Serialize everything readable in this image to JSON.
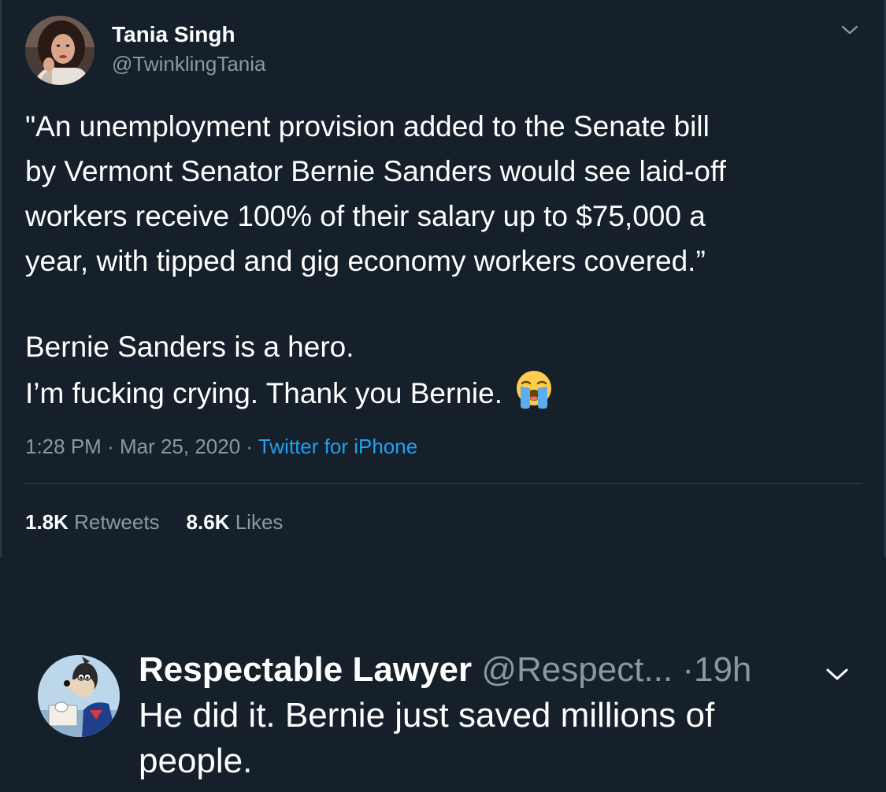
{
  "tweet": {
    "author": {
      "display_name": "Tania Singh",
      "handle": "@TwinklingTania",
      "avatar_icon": "profile-photo-avatar"
    },
    "text_lines": [
      "\"An unemployment provision added to the Senate bill",
      "by Vermont Senator Bernie Sanders would see laid-off",
      "workers receive 100% of their salary up to $75,000 a",
      "year, with tipped and gig economy workers covered.”",
      "Bernie Sanders is a hero.",
      "I’m fucking crying. Thank you Bernie."
    ],
    "emoji": "loudly-crying-face-icon",
    "time": "1:28 PM",
    "separator": "·",
    "date": "Mar 25, 2020",
    "source": "Twitter for iPhone",
    "retweets_count": "1.8K",
    "retweets_label": "Retweets",
    "likes_count": "8.6K",
    "likes_label": "Likes",
    "menu_icon": "chevron-down-icon"
  },
  "reply": {
    "display_name": "Respectable Lawyer",
    "handle": "@Respect...",
    "separator": "·",
    "time": "19h",
    "avatar_icon": "cartoon-dog-avatar",
    "text_lines": [
      "He did it. Bernie just saved millions of",
      "people."
    ],
    "menu_icon": "chevron-down-icon"
  },
  "colors": {
    "background": "#15202b",
    "primary_text": "#ffffff",
    "secondary_text": "#8899a6",
    "link": "#1da1f2",
    "divider": "#38444d"
  }
}
